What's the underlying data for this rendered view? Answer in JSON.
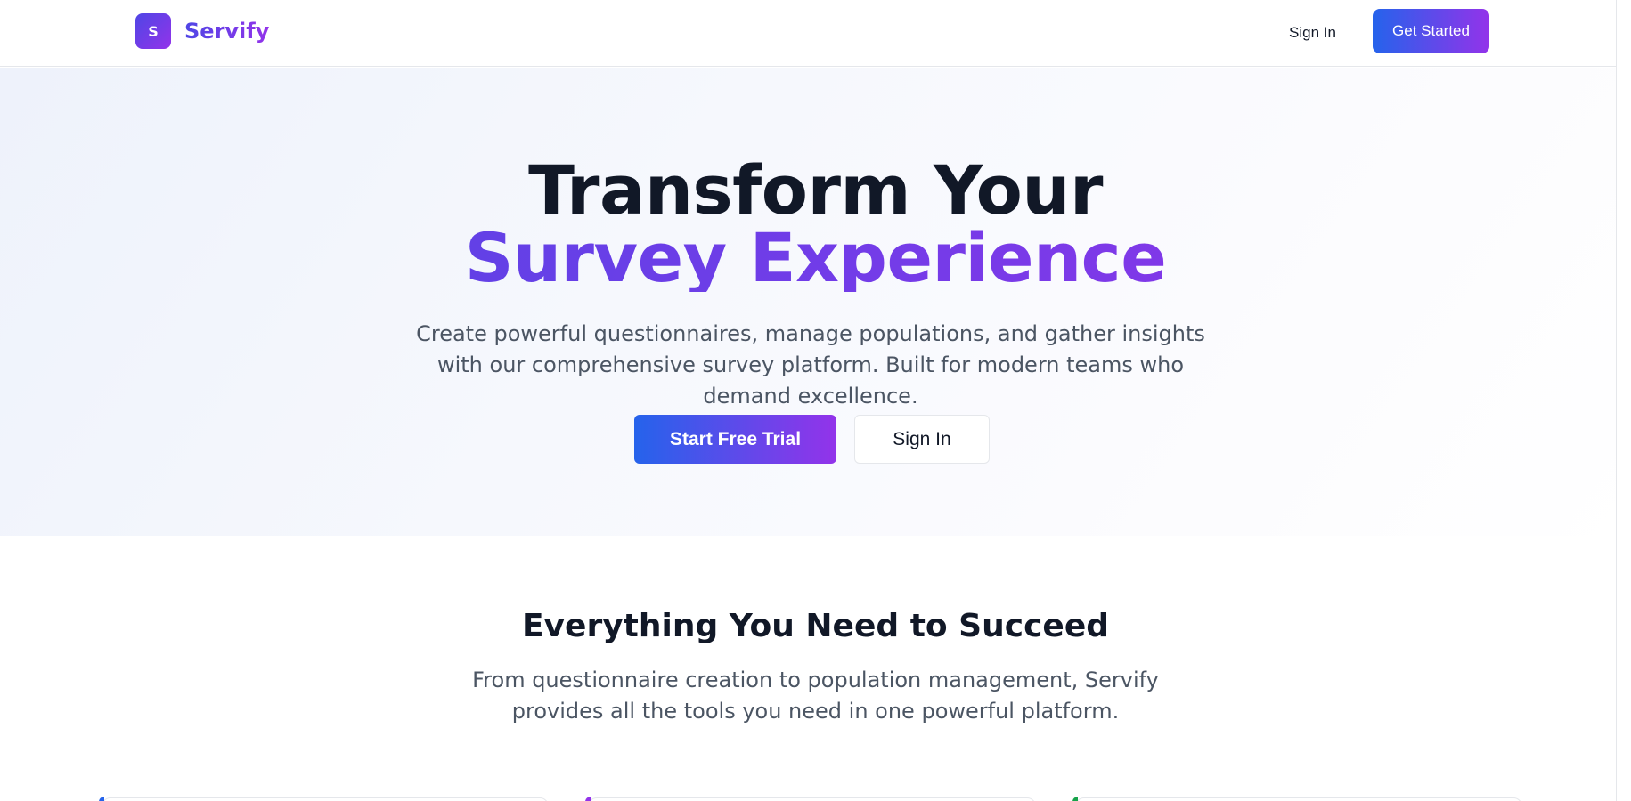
{
  "colors": {
    "brand_start": "#4f46e5",
    "brand_end": "#9333ea",
    "cta_start": "#2563eb",
    "cta_end": "#9333ea",
    "text_dark": "#111827",
    "text_muted": "#4b5563"
  },
  "nav": {
    "brand_initial": "S",
    "brand_name": "Servify",
    "sign_in": "Sign In",
    "get_started": "Get Started"
  },
  "hero": {
    "title_line1": "Transform Your",
    "title_line2": "Survey Experience",
    "subtitle": "Create powerful questionnaires, manage populations, and gather insights with our comprehensive survey platform. Built for modern teams who demand excellence.",
    "primary_cta": "Start Free Trial",
    "secondary_cta": "Sign In"
  },
  "features": {
    "title": "Everything You Need to Succeed",
    "subtitle": "From questionnaire creation to population management, Servify provides all the tools you need in one powerful platform."
  }
}
